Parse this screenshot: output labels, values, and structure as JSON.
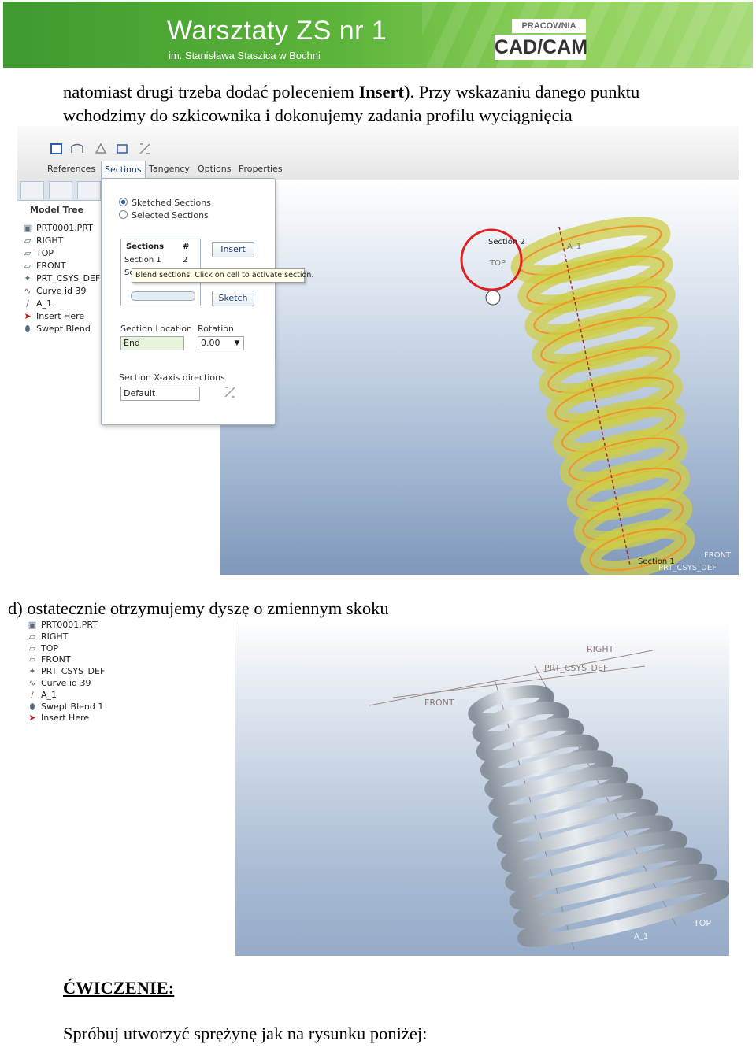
{
  "banner": {
    "title": "Warsztaty ZS nr 1",
    "subtitle": "im. Stanisława Staszica w Bochni",
    "badge_top": "PRACOWNIA",
    "badge_main": "CAD/CAM"
  },
  "intro": {
    "line1_a": "natomiast drugi trzeba dodać poleceniem ",
    "line1_bold": "Insert",
    "line1_b": "). Przy wskazaniu danego punktu",
    "line2": "wchodzimy do szkicownika i dokonujemy zadania profilu wyciągnięcia"
  },
  "shot1": {
    "tabs": [
      "References",
      "Sections",
      "Tangency",
      "Options",
      "Properties"
    ],
    "active_tab": "Sections",
    "tree_title": "Model Tree",
    "tree": [
      {
        "icon": "part-icon",
        "label": "PRT0001.PRT"
      },
      {
        "icon": "datum-plane-icon",
        "label": "RIGHT"
      },
      {
        "icon": "datum-plane-icon",
        "label": "TOP"
      },
      {
        "icon": "datum-plane-icon",
        "label": "FRONT"
      },
      {
        "icon": "csys-icon",
        "label": "PRT_CSYS_DEF"
      },
      {
        "icon": "curve-icon",
        "label": "Curve id 39"
      },
      {
        "icon": "axis-icon",
        "label": "A_1"
      },
      {
        "icon": "insert-arrow-icon",
        "label": "Insert Here"
      },
      {
        "icon": "swept-blend-icon",
        "label": "Swept Blend"
      }
    ],
    "dialog": {
      "radio_sketched": "Sketched Sections",
      "radio_selected": "Selected Sections",
      "table_header_name": "Sections",
      "table_header_num": "#",
      "row1_name": "Section 1",
      "row1_num": "2",
      "row2_name": "Se",
      "insert_button": "Insert",
      "sketch_button": "Sketch",
      "tooltip": "Blend sections. Click on cell to activate section.",
      "section_location_label": "Section Location",
      "section_location_value": "End",
      "rotation_label": "Rotation",
      "rotation_value": "0.00",
      "xaxis_label": "Section X-axis directions",
      "xaxis_value": "Default"
    },
    "viewport_labels": {
      "section2": "Section 2",
      "top": "TOP",
      "a1": "A_1",
      "section1": "Section 1",
      "front": "FRONT",
      "csys": "PRT_CSYS_DEF"
    }
  },
  "section_d": {
    "heading": "d) ostatecznie otrzymujemy dyszę o zmiennym skoku"
  },
  "shot2": {
    "tree": [
      {
        "icon": "part-icon",
        "label": "PRT0001.PRT"
      },
      {
        "icon": "datum-plane-icon",
        "label": "RIGHT"
      },
      {
        "icon": "datum-plane-icon",
        "label": "TOP"
      },
      {
        "icon": "datum-plane-icon",
        "label": "FRONT"
      },
      {
        "icon": "csys-icon",
        "label": "PRT_CSYS_DEF"
      },
      {
        "icon": "curve-icon",
        "label": "Curve id 39"
      },
      {
        "icon": "axis-icon",
        "label": "A_1"
      },
      {
        "icon": "swept-blend-icon",
        "label": "Swept Blend 1"
      },
      {
        "icon": "insert-arrow-icon",
        "label": "Insert Here"
      }
    ],
    "viewport_labels": {
      "right": "RIGHT",
      "csys": "PRT_CSYS_DEF",
      "front": "FRONT",
      "top": "TOP",
      "a1": "A_1"
    }
  },
  "exercise": {
    "heading": "ĆWICZENIE:",
    "text": "Spróbuj utworzyć sprężynę jak na rysunku poniżej:"
  }
}
